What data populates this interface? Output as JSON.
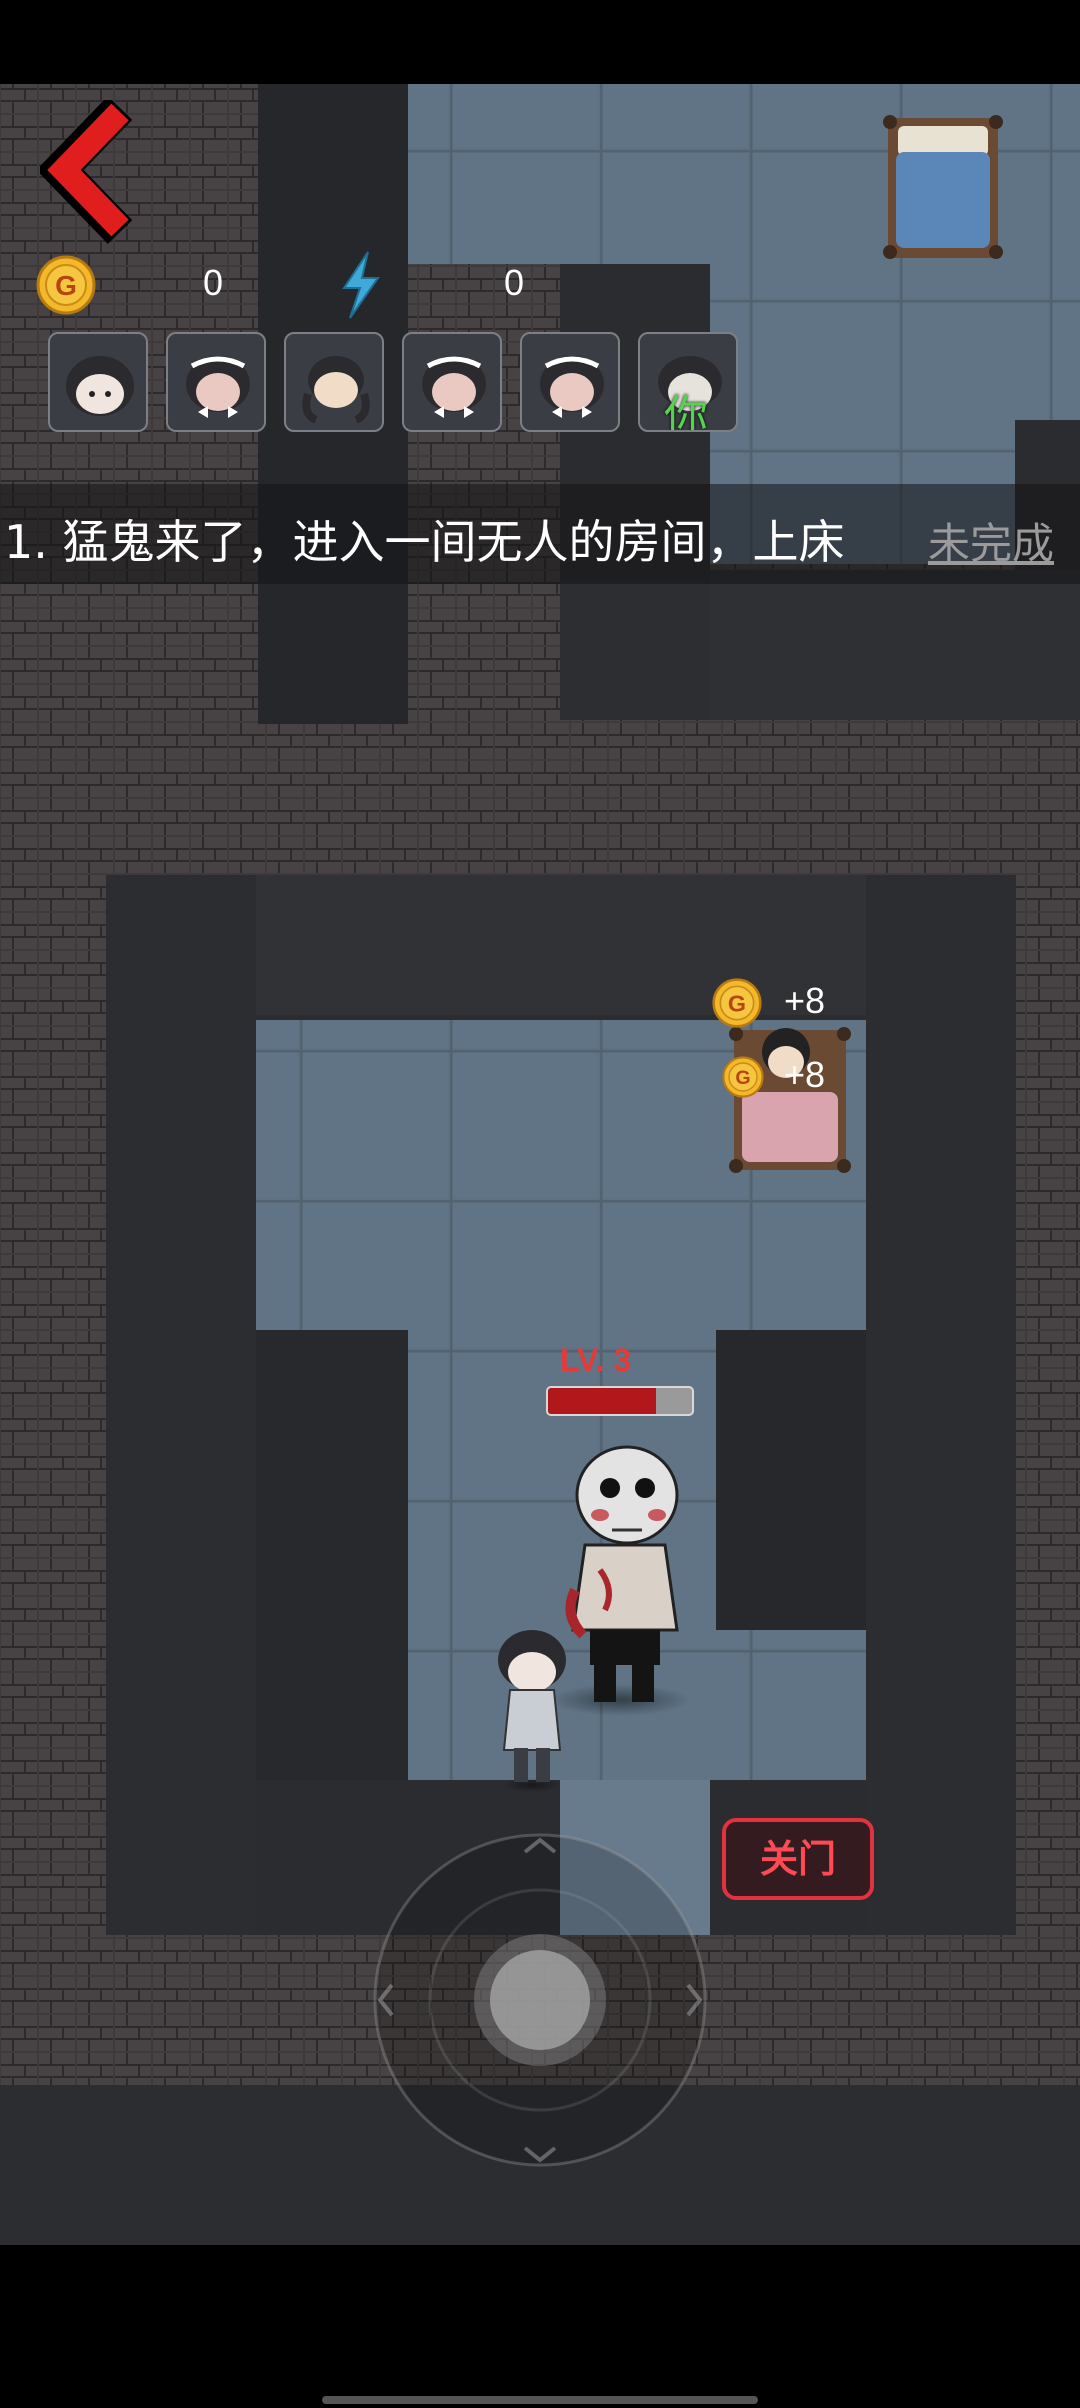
{
  "hud": {
    "coin_count": "0",
    "energy_count": "0",
    "coin_icon": "gold-coin-icon",
    "energy_icon": "lightning-bolt-icon",
    "back_icon": "red-back-arrow-icon"
  },
  "players": [
    {
      "name": "player-1",
      "avatar": "short-hair-girl-avatar",
      "is_you": false
    },
    {
      "name": "player-2",
      "avatar": "maid-headband-girl-avatar",
      "is_you": false
    },
    {
      "name": "player-3",
      "avatar": "pigtail-girl-avatar",
      "is_you": false
    },
    {
      "name": "player-4",
      "avatar": "maid-headband-girl-avatar",
      "is_you": false
    },
    {
      "name": "player-5",
      "avatar": "maid-headband-girl-avatar",
      "is_you": false
    },
    {
      "name": "player-6",
      "avatar": "short-hair-boy-avatar",
      "is_you": true,
      "tag": "你"
    }
  ],
  "task": {
    "text": "1. 猛鬼来了，进入一间无人的房间，上床",
    "status": "未完成"
  },
  "rewards": {
    "first": "+8",
    "second": "+8"
  },
  "ghost": {
    "level_label": "LV. 3",
    "hp_fraction": 0.75
  },
  "controls": {
    "close_door_label": "关门",
    "joystick_icon": "virtual-joystick-icon"
  },
  "colors": {
    "back_arrow": "#e01e1e",
    "hp_fill": "#b2171c",
    "close_door": "#e2313f",
    "you_tag": "#55d24e",
    "coin": "#f3b92a",
    "bolt": "#3fa9d8"
  }
}
